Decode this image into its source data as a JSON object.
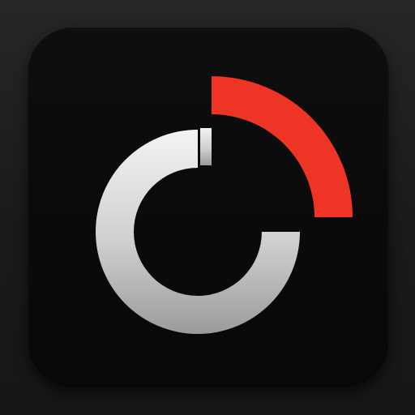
{
  "icon": {
    "name": "app-icon",
    "logo": "power-gauge-icon"
  },
  "colors": {
    "background": "#1f1f1f",
    "tile": "#0b0b0b",
    "ring_light": "#f2f2f2",
    "ring_dark": "#9a9a9a",
    "accent": "#ee3424"
  }
}
